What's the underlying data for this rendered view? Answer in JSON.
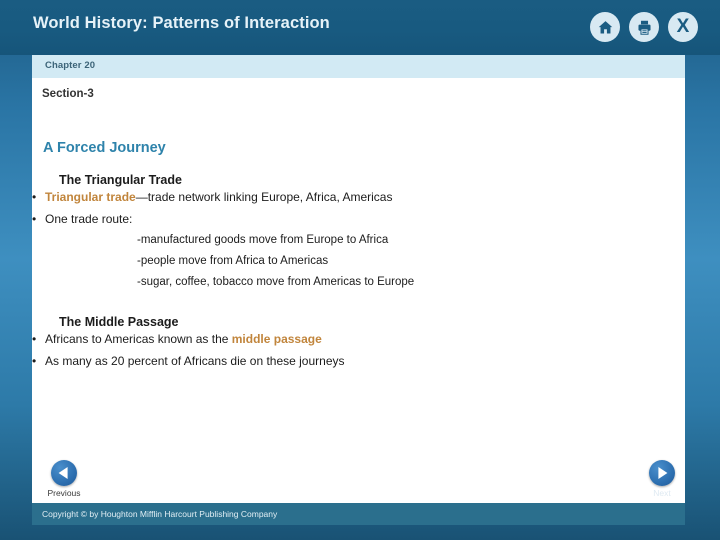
{
  "header": {
    "title": "World History: Patterns of Interaction",
    "icons": [
      {
        "name": "home-icon",
        "label": "Home"
      },
      {
        "name": "print-icon",
        "label": "Print"
      },
      {
        "name": "close-icon",
        "label": "X"
      }
    ]
  },
  "chapter": {
    "label": "Chapter 20"
  },
  "section": {
    "label": "Section-3"
  },
  "slide": {
    "title": "A Forced Journey",
    "blocks": [
      {
        "heading": "The Triangular Trade",
        "bullets": [
          {
            "highlight": "Triangular trade",
            "rest": "—trade network linking Europe, Africa, Americas"
          },
          {
            "highlight": "",
            "rest": "One trade route:"
          }
        ],
        "sublines": [
          "-manufactured goods move from Europe to Africa",
          "-people move from Africa to Americas",
          "-sugar, coffee, tobacco move from Americas to Europe"
        ]
      },
      {
        "heading": "The Middle Passage",
        "bullets": [
          {
            "pre": "Africans to Americas known as the ",
            "highlight": "middle passage",
            "rest": ""
          },
          {
            "pre": "As many as 20 percent of Africans die on these journeys",
            "highlight": "",
            "rest": ""
          }
        ],
        "sublines": []
      }
    ]
  },
  "nav": {
    "previous_label": "Previous",
    "next_label": "Next"
  },
  "footer": {
    "copyright": "Copyright © by Houghton Mifflin Harcourt Publishing Company"
  },
  "colors": {
    "header_bg": "#1a5c82",
    "accent_title": "#2e83ab",
    "highlight": "#c1853c",
    "chapter_bar": "#d2eaf4",
    "copyright_bar": "#2b6f8d"
  }
}
